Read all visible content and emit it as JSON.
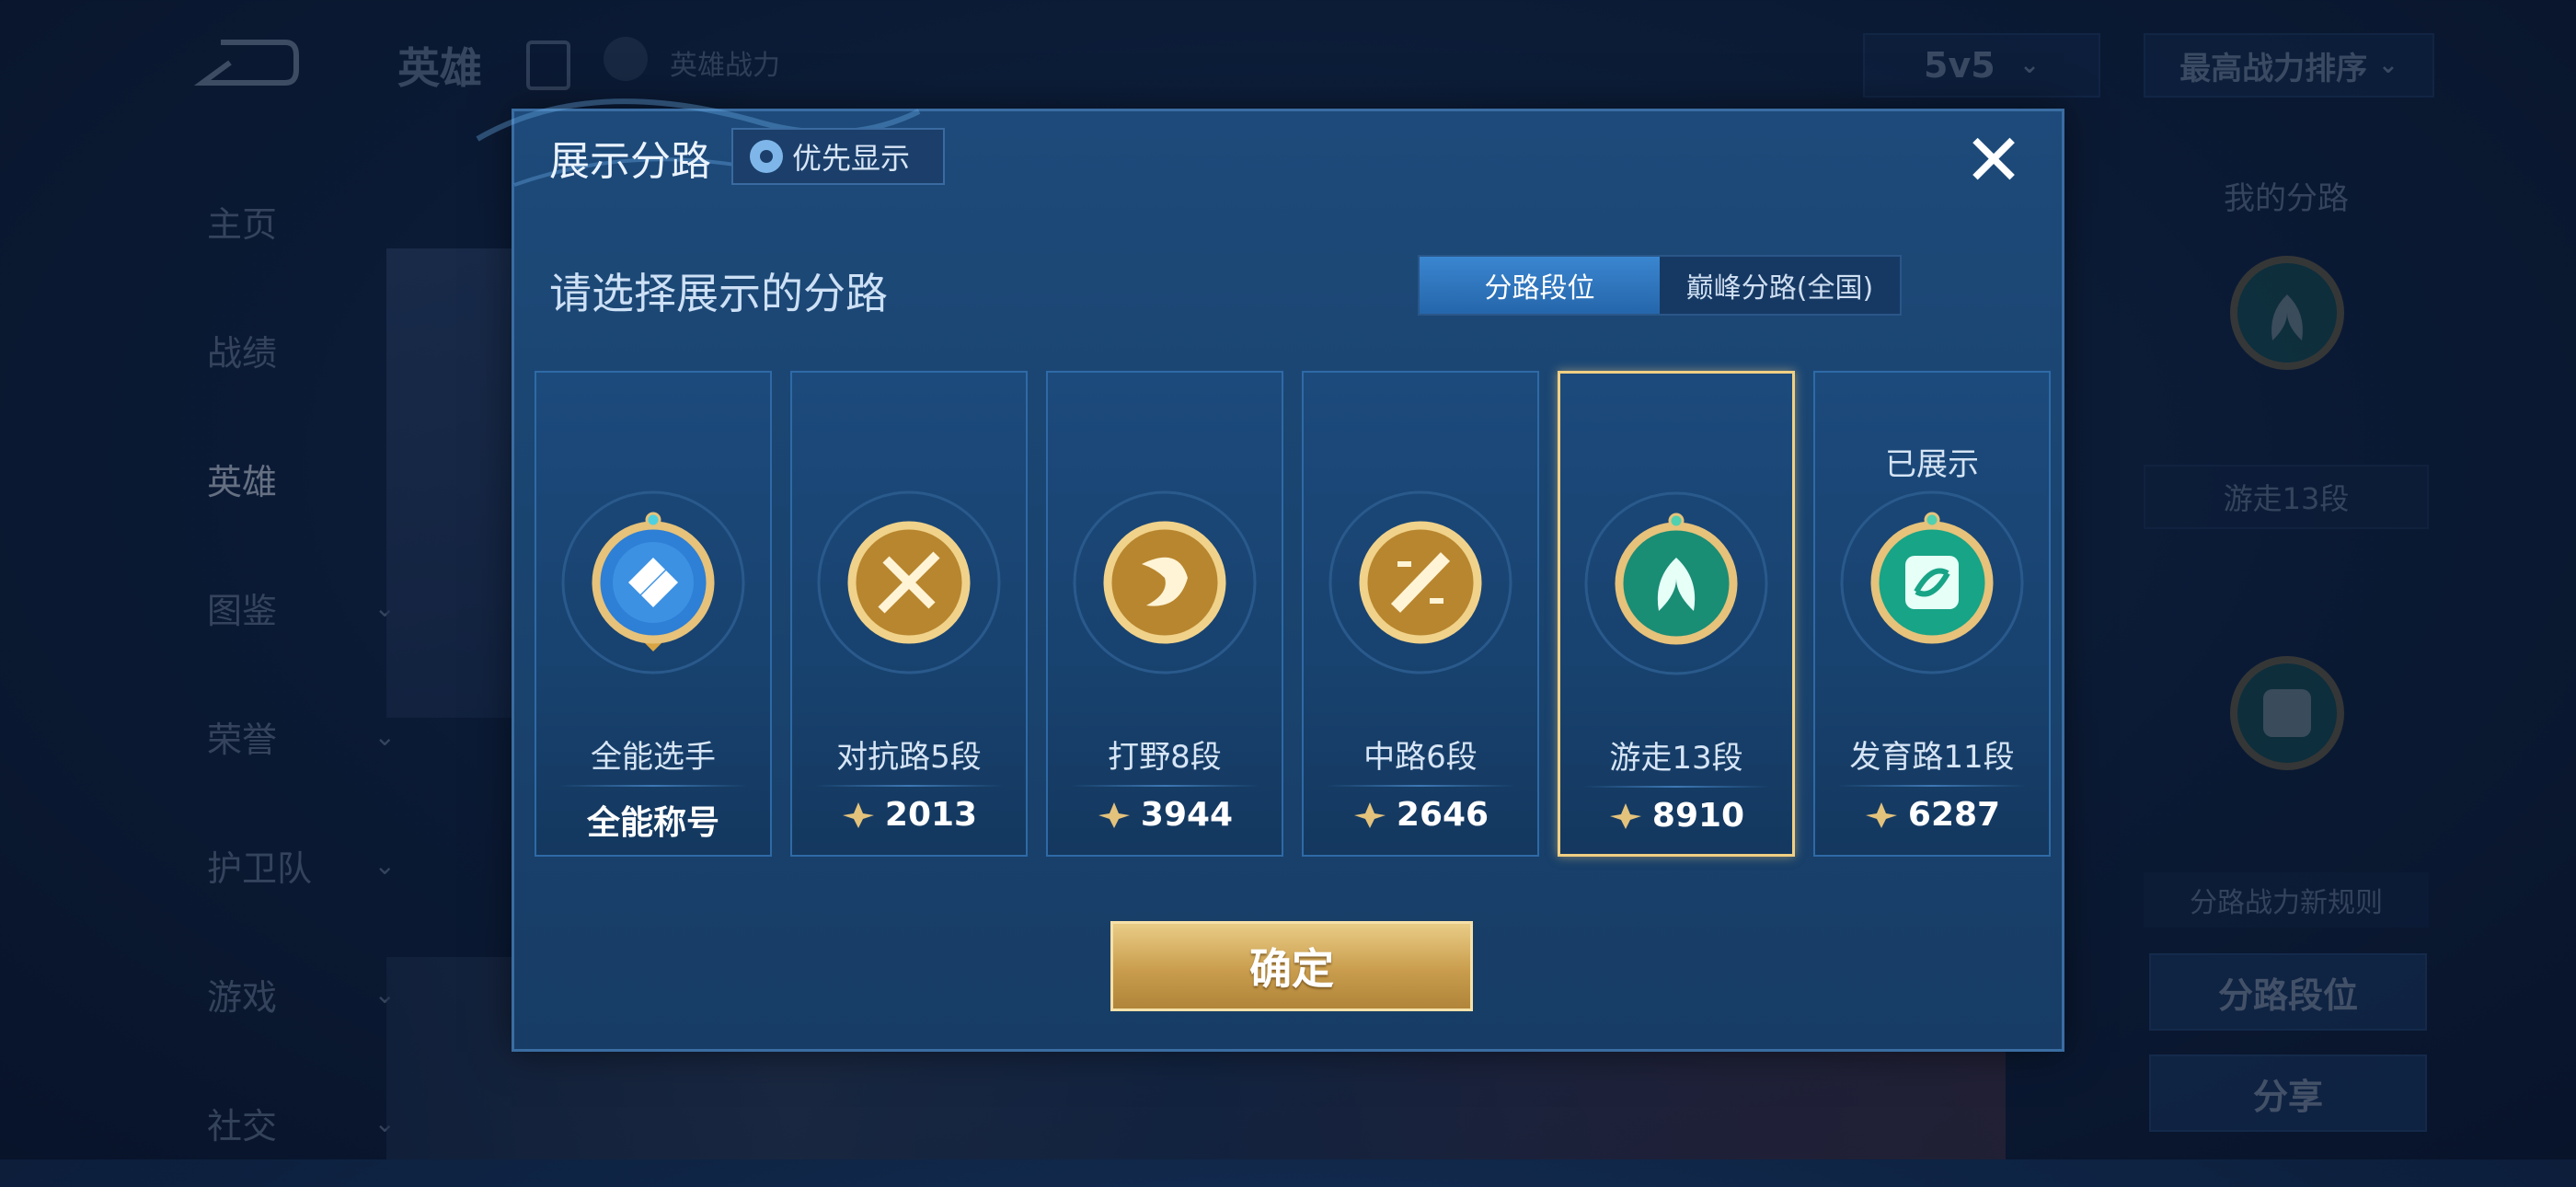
{
  "background": {
    "top_title": "英雄",
    "top_sub": "英雄战力",
    "mode_select": "5v5",
    "sort_select": "最高战力排序",
    "side_nav": [
      {
        "label": "主页",
        "chevron": ""
      },
      {
        "label": "战绩",
        "chevron": ""
      },
      {
        "label": "英雄",
        "chevron": ""
      },
      {
        "label": "图鉴",
        "chevron": "⌄"
      },
      {
        "label": "荣誉",
        "chevron": "⌄"
      },
      {
        "label": "护卫队",
        "chevron": "⌄"
      },
      {
        "label": "游戏",
        "chevron": "⌄"
      },
      {
        "label": "社交",
        "chevron": "⌄"
      }
    ],
    "right_panel": {
      "title": "我的分路",
      "lane_label": "游走13段",
      "rule_text": "分路战力新规则",
      "btn_lane": "分路段位",
      "btn_share": "分享"
    }
  },
  "modal": {
    "title": "展示分路",
    "priority_label": "优先显示",
    "close": "✕",
    "subtitle": "请选择展示的分路",
    "tabs": [
      {
        "label": "分路段位",
        "active": true
      },
      {
        "label": "巅峰分路(全国)",
        "active": false
      }
    ],
    "cards": [
      {
        "name": "全能选手",
        "value": "全能称号",
        "has_power_icon": false,
        "shown": "",
        "selected": false,
        "emblem": "all-round-emblem",
        "color": "#2e7fd6"
      },
      {
        "name": "对抗路5段",
        "value": "2013",
        "has_power_icon": true,
        "shown": "",
        "selected": false,
        "emblem": "clash-lane-emblem",
        "color": "#d9a441"
      },
      {
        "name": "打野8段",
        "value": "3944",
        "has_power_icon": true,
        "shown": "",
        "selected": false,
        "emblem": "jungle-emblem",
        "color": "#d9a441"
      },
      {
        "name": "中路6段",
        "value": "2646",
        "has_power_icon": true,
        "shown": "",
        "selected": false,
        "emblem": "mid-lane-emblem",
        "color": "#d9a441"
      },
      {
        "name": "游走13段",
        "value": "8910",
        "has_power_icon": true,
        "shown": "",
        "selected": true,
        "emblem": "roam-emblem",
        "color": "#1fa58a"
      },
      {
        "name": "发育路11段",
        "value": "6287",
        "has_power_icon": true,
        "shown": "已展示",
        "selected": false,
        "emblem": "farm-lane-emblem",
        "color": "#1fb894"
      }
    ],
    "confirm": "确定"
  }
}
